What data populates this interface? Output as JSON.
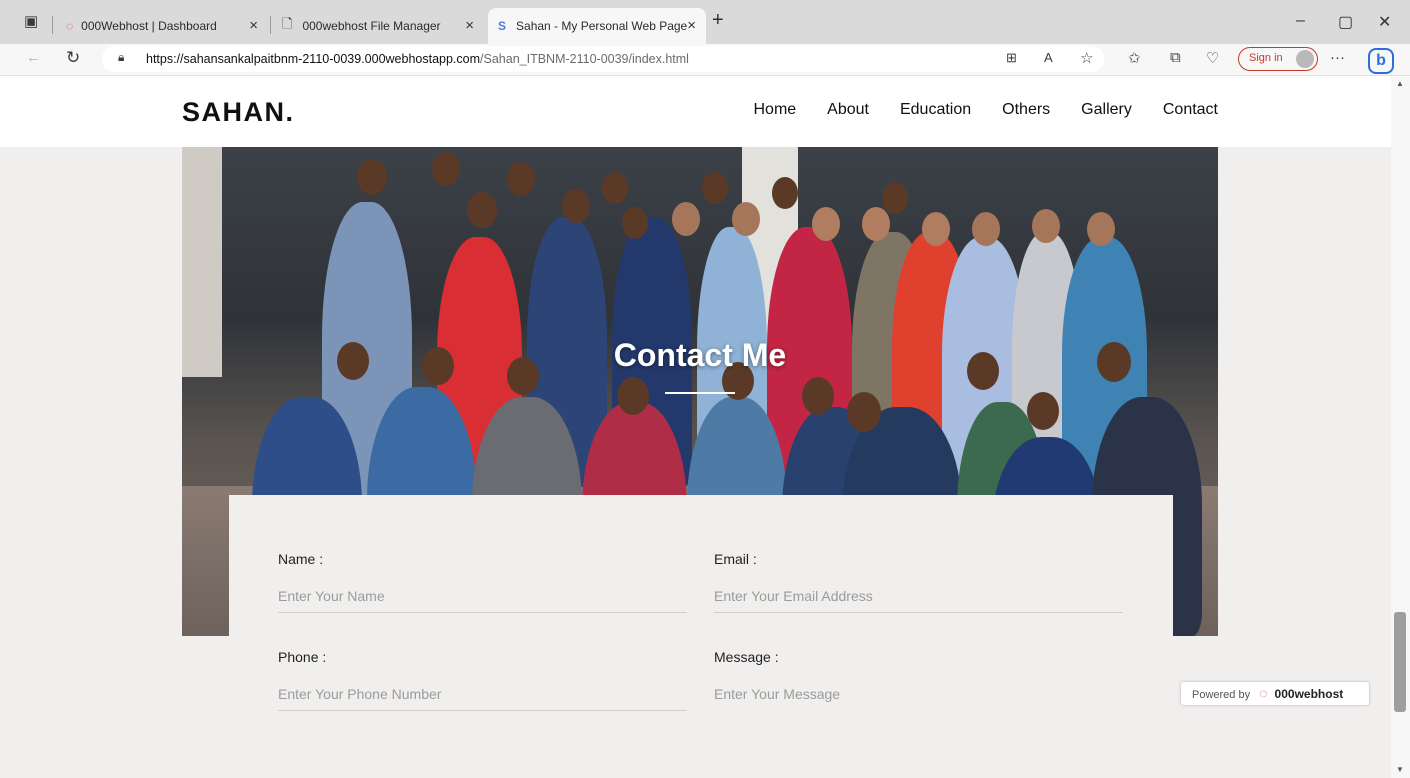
{
  "browser": {
    "tabs": [
      {
        "title": "000Webhost | Dashboard",
        "icon": "webhost-swirl-icon"
      },
      {
        "title": "000webhost File Manager",
        "icon": "document-icon"
      },
      {
        "title": "Sahan - My Personal Web Page",
        "icon": "s-logo-icon",
        "active": true
      }
    ],
    "tab_close_glyph": "×",
    "new_tab_glyph": "+",
    "window_controls": {
      "minimize": "–",
      "restore": "▢",
      "close": "✕"
    },
    "url_host": "https://sahansankalpaitbnm-2110-0039.000webhostapp.com",
    "url_path": "/Sahan_ITBNM-2110-0039/index.html",
    "sign_in": "Sign in",
    "more_glyph": "···",
    "bing_letter": "b"
  },
  "site": {
    "logo": "SAHAN.",
    "nav": [
      "Home",
      "About",
      "Education",
      "Others",
      "Gallery",
      "Contact"
    ]
  },
  "hero": {
    "title": "Contact Me"
  },
  "form": {
    "name_label": "Name :",
    "name_placeholder": "Enter Your Name",
    "email_label": "Email :",
    "email_placeholder": "Enter Your Email Address",
    "phone_label": "Phone :",
    "phone_placeholder": "Enter Your Phone Number",
    "message_label": "Message :",
    "message_placeholder": "Enter Your Message"
  },
  "badge": {
    "powered_by": "Powered by",
    "brand": "000webhost"
  }
}
